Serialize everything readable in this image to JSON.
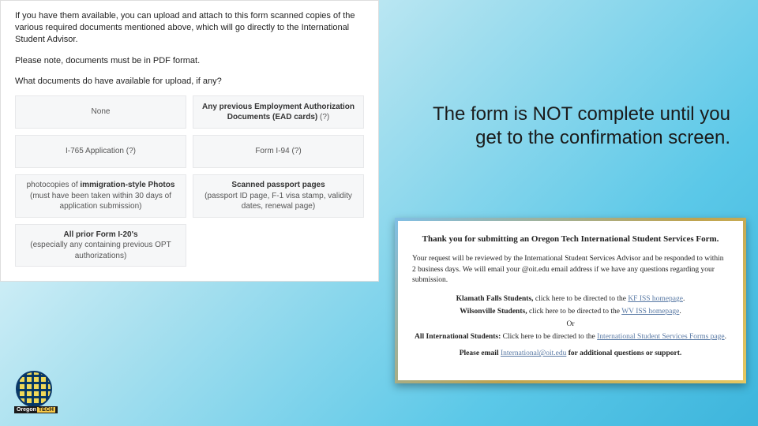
{
  "form": {
    "intro": "If you have them available, you can upload and attach to this form scanned copies of the various required documents mentioned above, which will go directly to the International Student Advisor.",
    "note": "Please note, documents must be in PDF format.",
    "question": "What documents do have available for upload, if any?",
    "options": {
      "none": "None",
      "ead_bold": "Any previous Employment Authorization Documents (EAD cards)",
      "ead_suffix": " (?)",
      "i765": "I-765 Application (?)",
      "i94": "Form I-94 (?)",
      "photos_pre": "photocopies of ",
      "photos_bold": "immigration-style Photos",
      "photos_rest": "(must have been taken within 30 days of application submission)",
      "passport_bold": "Scanned passport pages",
      "passport_rest": "(passport ID page, F-1 visa stamp, validity dates, renewal page)",
      "i20_bold": "All prior Form I-20's",
      "i20_rest": "(especially any containing previous OPT authorizations)"
    }
  },
  "callout": "The form is NOT complete until you get to the confirmation screen.",
  "confirm": {
    "thanks": "Thank you for submitting an Oregon Tech International Student Services Form.",
    "body1": "Your request will be reviewed by the International Student Services Advisor and be responded to within 2 business days. We will email your @oit.edu email address if we have any questions regarding your submission.",
    "kf_pre": "Klamath Falls Students,",
    "kf_mid": " click here to be directed to the ",
    "kf_link": "KF ISS homepage",
    "wv_pre": "Wilsonville Students,",
    "wv_mid": " click here to be directed to the ",
    "wv_link": "WV ISS homepage",
    "or": "Or",
    "all_pre": "All International Students:",
    "all_mid": " Click here to be directed to the ",
    "all_link": "International Student Services Forms page",
    "email_pre": "Please email ",
    "email_link": "International@oit.edu",
    "email_post": " for additional questions or support."
  },
  "logo": {
    "brand": "Oregon",
    "tech": "TECH"
  }
}
